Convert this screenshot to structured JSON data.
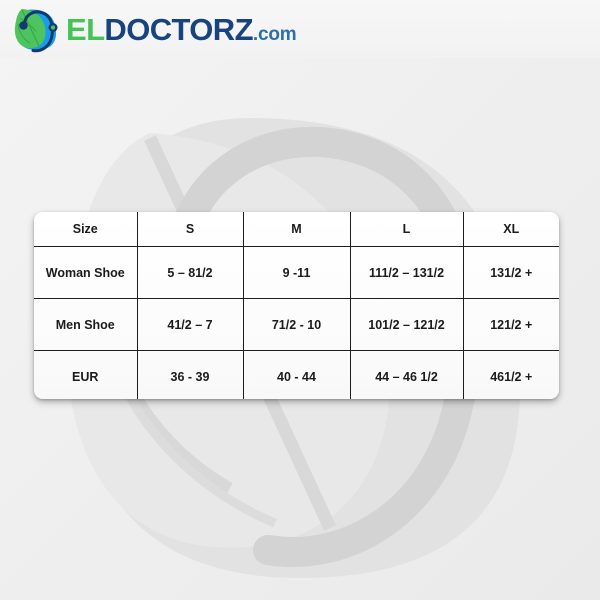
{
  "brand": {
    "logo_icon": "leaf-stethoscope-icon",
    "text_part1": "EL",
    "text_part2": "DOCTORZ",
    "text_part3": ".com",
    "color_green": "#45c356",
    "color_navy": "#17447f",
    "color_blue": "#2f6fa8"
  },
  "background": {
    "watermark_icon": "leaf-stethoscope-watermark",
    "base_color": "#efefef",
    "watermark_color": "#dcdcdc"
  },
  "size_table": {
    "headers": [
      "Size",
      "S",
      "M",
      "L",
      "XL"
    ],
    "rows": [
      {
        "label": "Woman Shoe",
        "s": "5 – 81/2",
        "m": "9 -11",
        "l": "111/2 – 131/2",
        "xl": "131/2 +"
      },
      {
        "label": "Men Shoe",
        "s": "41/2 – 7",
        "m": "71/2 - 10",
        "l": "101/2 – 121/2",
        "xl": "121/2 +"
      },
      {
        "label": "EUR",
        "s": "36 - 39",
        "m": "40 - 44",
        "l": "44 – 46 1/2",
        "xl": "461/2 +"
      }
    ]
  }
}
